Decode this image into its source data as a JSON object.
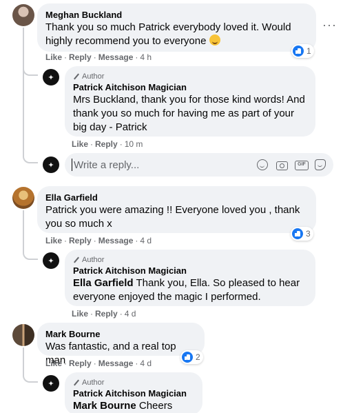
{
  "comments": [
    {
      "name": "Meghan Buckland",
      "text": "Thank you so much Patrick everybody loved it. Would highly recommend you to everyone",
      "emoji": "smiling-face",
      "actions": {
        "like": "Like",
        "reply": "Reply",
        "message": "Message",
        "time": "4 h"
      },
      "reactions": "1",
      "reply": {
        "badge": "Author",
        "name": "Patrick Aitchison Magician",
        "mention": "",
        "text": "Mrs Buckland, thank you for those kind words! And thank you so much for having me as part of your big day - Patrick",
        "actions": {
          "like": "Like",
          "reply": "Reply",
          "time": "10 m"
        }
      }
    },
    {
      "name": "Ella Garfield",
      "text": "Patrick you were amazing !! Everyone loved you , thank you so much x",
      "actions": {
        "like": "Like",
        "reply": "Reply",
        "message": "Message",
        "time": "4 d"
      },
      "reactions": "3",
      "reply": {
        "badge": "Author",
        "name": "Patrick Aitchison Magician",
        "mention": "Ella Garfield",
        "text": "Thank you, Ella. So pleased to hear everyone enjoyed the magic I performed.",
        "actions": {
          "like": "Like",
          "reply": "Reply",
          "time": "4 d"
        }
      }
    },
    {
      "name": "Mark Bourne",
      "text": "Was fantastic, and a real top man",
      "actions": {
        "like": "Like",
        "reply": "Reply",
        "message": "Message",
        "time": "4 d"
      },
      "reactions": "2",
      "reply": {
        "badge": "Author",
        "name": "Patrick Aitchison Magician",
        "mention": "Mark Bourne",
        "text": "Cheers Mark!"
      }
    }
  ],
  "reply_box": {
    "placeholder": "Write a reply..."
  },
  "colors": {
    "bubble": "#f0f2f5",
    "meta": "#65676b",
    "like_blue": "#1877f2"
  },
  "icons": {
    "more": "more-options-icon",
    "author_badge": "pen-icon",
    "like": "like-thumb-icon"
  }
}
